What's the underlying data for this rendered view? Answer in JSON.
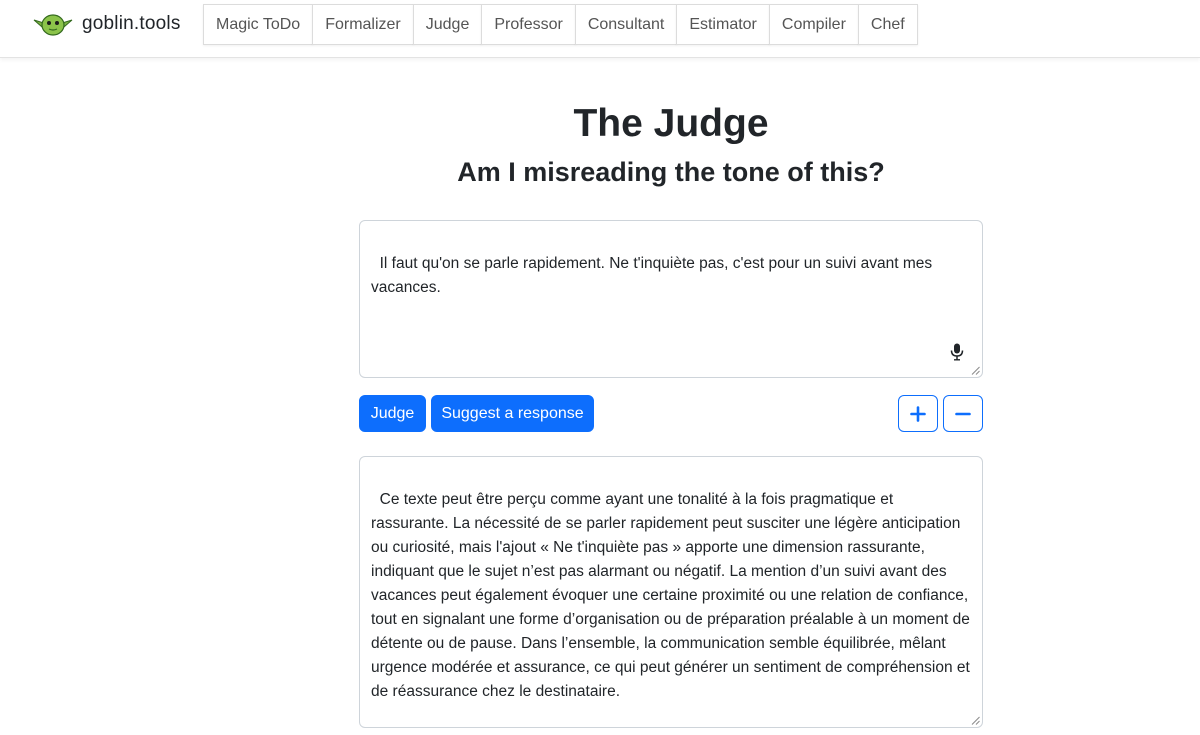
{
  "brand": {
    "name": "goblin.tools",
    "logo_icon": "goblin-head-icon"
  },
  "nav": {
    "tabs": [
      {
        "label": "Magic ToDo"
      },
      {
        "label": "Formalizer"
      },
      {
        "label": "Judge"
      },
      {
        "label": "Professor"
      },
      {
        "label": "Consultant"
      },
      {
        "label": "Estimator"
      },
      {
        "label": "Compiler"
      },
      {
        "label": "Chef"
      }
    ]
  },
  "main": {
    "title": "The Judge",
    "subtitle": "Am I misreading the tone of this?",
    "input_text": "Il faut qu'on se parle rapidement. Ne t'inquiète pas, c'est pour un suivi avant mes vacances.",
    "buttons": {
      "judge": "Judge",
      "suggest": "Suggest a response",
      "increase": "+",
      "decrease": "−"
    },
    "output_text": "Ce texte peut être perçu comme ayant une tonalité à la fois pragmatique et rassurante. La nécessité de se parler rapidement peut susciter une légère anticipation ou curiosité, mais l'ajout « Ne t'inquiète pas » apporte une dimension rassurante, indiquant que le sujet n’est pas alarmant ou négatif. La mention d’un suivi avant des vacances peut également évoquer une certaine proximité ou une relation de confiance, tout en signalant une forme d’organisation ou de préparation préalable à un moment de détente ou de pause. Dans l’ensemble, la communication semble équilibrée, mêlant urgence modérée et assurance, ce qui peut générer un sentiment de compréhension et de réassurance chez le destinataire."
  },
  "colors": {
    "primary": "#0d6efd",
    "logo_green": "#8bc34a"
  }
}
